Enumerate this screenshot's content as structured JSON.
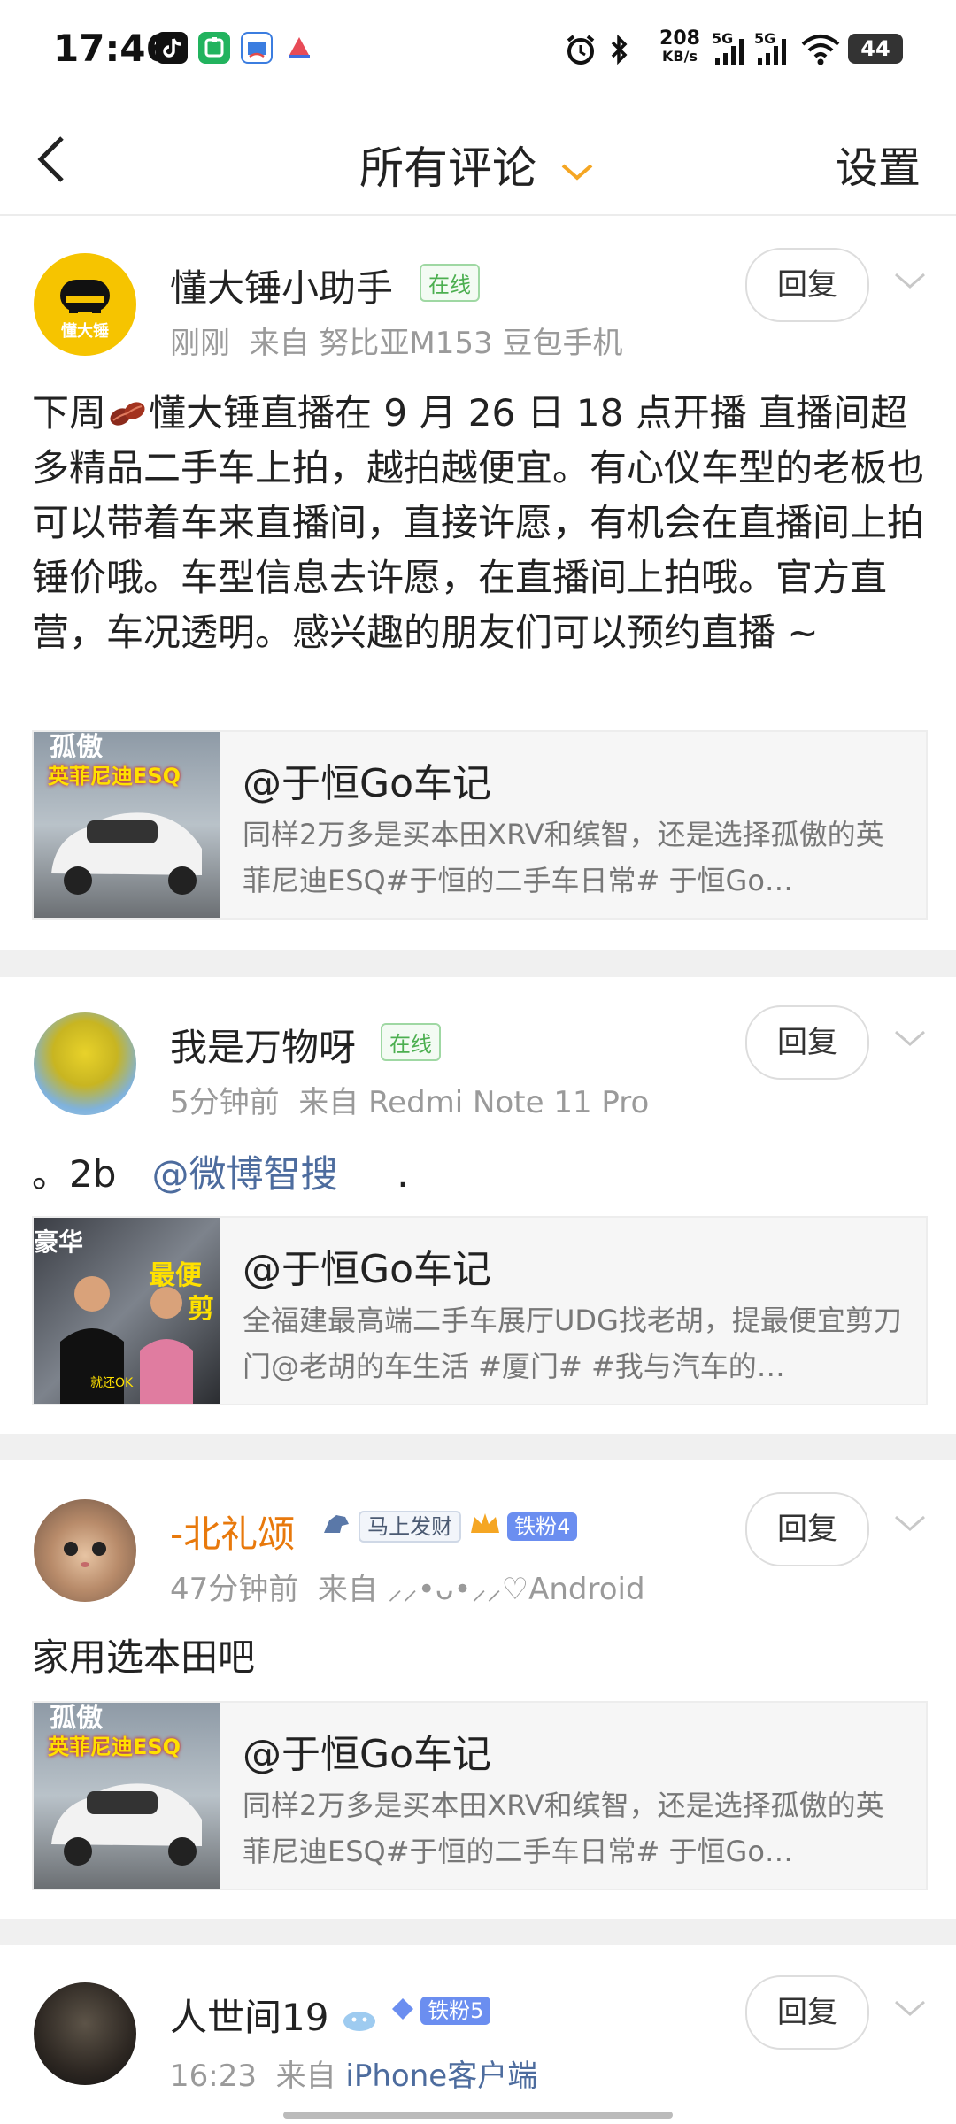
{
  "status_bar": {
    "time": "17:46",
    "speed": "208",
    "speed_unit": "KB/s",
    "net1": "5G",
    "net2": "5G",
    "battery": "44"
  },
  "nav": {
    "title": "所有评论",
    "settings": "设置"
  },
  "comments": [
    {
      "name": "懂大锤小助手",
      "online": "在线",
      "time": "刚刚",
      "source": "来自 努比亚M153 豆包手机",
      "reply": "回复",
      "avatar_text": "懂大锤",
      "text_before": "下周",
      "text_after": "懂大锤直播在 9 月 26 日 18 点开播 直播间超多精品二手车上拍，越拍越便宜。有心仪车型的老板也可以带着车来直播间，直接许愿，有机会在直播间上拍锤价哦。车型信息去许愿，在直播间上拍哦。官方直营，车况透明。感兴趣的朋友们可以预约直播 ~",
      "share": {
        "title": "@于恒Go车记",
        "desc": "同样2万多是买本田XRV和缤智，还是选择孤傲的英菲尼迪ESQ#于恒的二手车日常# 于恒Go…",
        "thumb_top": "孤傲",
        "thumb_label": "英菲尼迪ESQ"
      }
    },
    {
      "name": "我是万物呀",
      "online": "在线",
      "time": "5分钟前",
      "source": "来自 Redmi Note 11 Pro",
      "reply": "回复",
      "text_a": "。2b",
      "mention": "@微博智搜",
      "text_b": ".",
      "share": {
        "title": "@于恒Go车记",
        "desc": "全福建最高端二手车展厅UDG找老胡，提最便宜剪刀门@老胡的车生活 #厦门# #我与汽车的…",
        "thumb_tl": "豪华",
        "thumb_tr": "最便",
        "thumb_br": "剪",
        "thumb_sub": "就还OK"
      }
    },
    {
      "name": "-北礼颂",
      "tag1": "马上发财",
      "tag2": "铁粉4",
      "time": "47分钟前",
      "source": "来自 ⸝⸝•ᴗ•⸝⸝♡Android",
      "reply": "回复",
      "text": "家用选本田吧",
      "share": {
        "title": "@于恒Go车记",
        "desc": "同样2万多是买本田XRV和缤智，还是选择孤傲的英菲尼迪ESQ#于恒的二手车日常# 于恒Go…",
        "thumb_top": "孤傲",
        "thumb_label": "英菲尼迪ESQ"
      }
    },
    {
      "name": "人世间19",
      "tag2": "铁粉5",
      "time": "16:23",
      "source_prefix": "来自",
      "source_link": "iPhone客户端",
      "reply": "回复"
    }
  ],
  "colors": {
    "accent_orange": "#f5a623",
    "mention_blue": "#4d6c9e",
    "online_green": "#4caf50",
    "vip_orange": "#e8790c"
  }
}
